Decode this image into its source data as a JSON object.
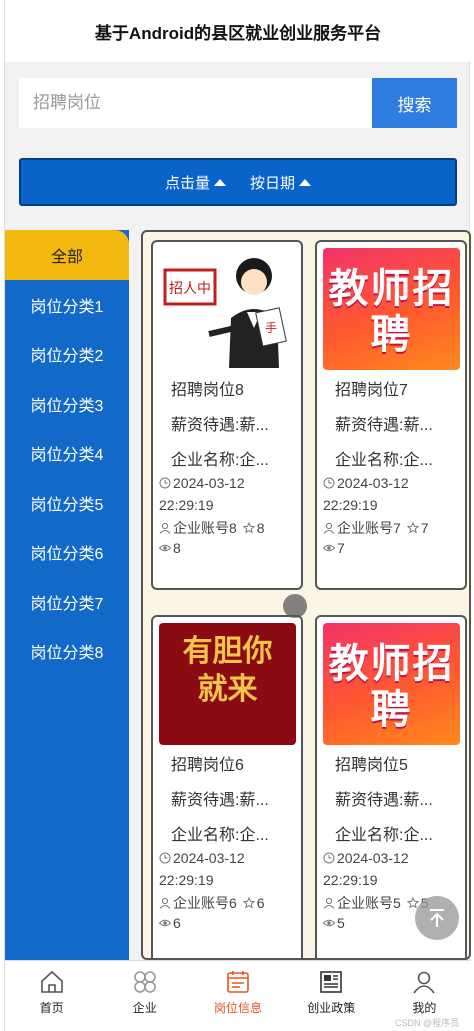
{
  "header": {
    "title": "基于Android的县区就业创业服务平台"
  },
  "search": {
    "placeholder": "招聘岗位",
    "button_label": "搜索"
  },
  "sort": {
    "clicks_label": "点击量",
    "date_label": "按日期"
  },
  "sidebar": {
    "items": [
      {
        "label": "全部",
        "active": true
      },
      {
        "label": "岗位分类1"
      },
      {
        "label": "岗位分类2"
      },
      {
        "label": "岗位分类3"
      },
      {
        "label": "岗位分类4"
      },
      {
        "label": "岗位分类5"
      },
      {
        "label": "岗位分类6"
      },
      {
        "label": "岗位分类7"
      },
      {
        "label": "岗位分类8"
      }
    ]
  },
  "cards": [
    {
      "image": "recruiting-cartoon",
      "image_text": "招人中",
      "title": "招聘岗位8",
      "salary": "薪资待遇:薪...",
      "company": "企业名称:企...",
      "date": "2024-03-12",
      "time": "22:29:19",
      "account": "企业账号8",
      "stars": "8",
      "views": "8"
    },
    {
      "image": "teacher-recruit-poster",
      "image_text": "教师招聘",
      "title": "招聘岗位7",
      "salary": "薪资待遇:薪...",
      "company": "企业名称:企...",
      "date": "2024-03-12",
      "time": "22:29:19",
      "account": "企业账号7",
      "stars": "7",
      "views": "7"
    },
    {
      "image": "brave-come-poster",
      "image_text": "有胆你就来",
      "title": "招聘岗位6",
      "salary": "薪资待遇:薪...",
      "company": "企业名称:企...",
      "date": "2024-03-12",
      "time": "22:29:19",
      "account": "企业账号6",
      "stars": "6",
      "views": "6"
    },
    {
      "image": "teacher-recruit-poster",
      "image_text": "教师招聘",
      "title": "招聘岗位5",
      "salary": "薪资待遇:薪...",
      "company": "企业名称:企...",
      "date": "2024-03-12",
      "time": "22:29:19",
      "account": "企业账号5",
      "stars": "5",
      "views": "5"
    }
  ],
  "tabbar": {
    "items": [
      {
        "label": "首页",
        "icon": "home-icon"
      },
      {
        "label": "企业",
        "icon": "grid-icon"
      },
      {
        "label": "岗位信息",
        "icon": "calendar-icon",
        "active": true
      },
      {
        "label": "创业政策",
        "icon": "newspaper-icon"
      },
      {
        "label": "我的",
        "icon": "user-icon"
      }
    ]
  },
  "watermark": "CSDN @程序员gaqq",
  "colors": {
    "primary": "#0a63c9",
    "accent": "#f4b90f",
    "active_tab": "#e8561e",
    "search_button": "#2f7de1"
  }
}
